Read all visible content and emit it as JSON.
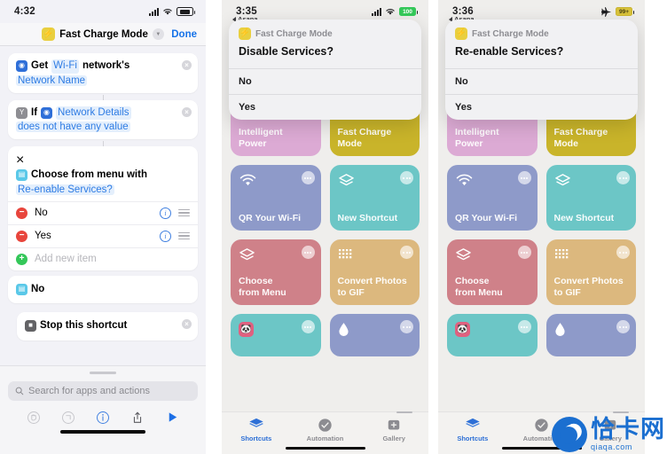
{
  "panel1": {
    "status": {
      "time": "4:32",
      "battery_text": "",
      "wifi": "wifi-icon",
      "signal": "signal-bars-icon"
    },
    "header": {
      "icon": "bolt-icon",
      "title": "Fast Charge Mode",
      "chevron": "chevron-down-icon",
      "done": "Done"
    },
    "actions": [
      {
        "icon": "wifi-action-icon",
        "line1_pre": "Get",
        "line1_var": "Wi-Fi",
        "line1_post": "network's",
        "line2": "Network Name",
        "close": "close-icon"
      },
      {
        "icon": "if-action-icon",
        "line1_pre": "If",
        "line1_var": "Network Details",
        "line1_post": "",
        "line2": "does not have any value",
        "close": "close-icon"
      }
    ],
    "menu_action": {
      "icon": "menu-action-icon",
      "title": "Choose from menu with",
      "variable": "Re-enable Services?",
      "close": "close-icon",
      "items": [
        {
          "label": "No",
          "remove": "remove-icon",
          "info": "info-icon",
          "drag": "drag-handle-icon"
        },
        {
          "label": "Yes",
          "remove": "remove-icon",
          "info": "info-icon",
          "drag": "drag-handle-icon"
        }
      ],
      "add_label": "Add new item",
      "add_icon": "add-icon"
    },
    "case_action": {
      "icon": "menu-case-icon",
      "label": "No"
    },
    "stop_action": {
      "icon": "stop-icon",
      "label": "Stop this shortcut",
      "close": "close-icon"
    },
    "search": {
      "placeholder": "Search for apps and actions",
      "icon": "search-icon"
    },
    "toolbar": [
      {
        "name": "undo-button",
        "glyph": "↺"
      },
      {
        "name": "redo-button",
        "glyph": "↻"
      },
      {
        "name": "info-button",
        "glyph": "i"
      },
      {
        "name": "share-button",
        "glyph": "↑"
      },
      {
        "name": "play-button",
        "glyph": "▶"
      }
    ]
  },
  "panel2": {
    "status": {
      "time": "3:35",
      "back_app": "Asana",
      "battery_text": "100",
      "battery_state": "green"
    },
    "dialog": {
      "app_icon": "bolt-icon",
      "app_name": "Fast Charge Mode",
      "question": "Disable Services?",
      "options": [
        "No",
        "Yes"
      ]
    },
    "tiles": [
      {
        "name": "Intelligent Power",
        "color": "#dcaad4",
        "icon": "battery-icon",
        "menu": "more-icon"
      },
      {
        "name": "Fast Charge Mode",
        "color": "#c9b42a",
        "icon": "bolt-icon",
        "menu": "message-icon"
      },
      {
        "name": "QR Your Wi-Fi",
        "color": "#8e9ac9",
        "icon": "wifi-icon",
        "menu": "more-icon"
      },
      {
        "name": "New Shortcut",
        "color": "#6cc6c6",
        "icon": "layers-icon",
        "menu": "more-icon"
      },
      {
        "name": "Choose\nfrom Menu",
        "color": "#cf8189",
        "icon": "layers-icon",
        "menu": "more-icon"
      },
      {
        "name": "Convert Photos\nto GIF",
        "color": "#dcb87e",
        "icon": "grid-icon",
        "menu": "more-icon"
      },
      {
        "name": "",
        "color": "#6cc6c6",
        "icon": "panda-icon",
        "menu": "more-icon"
      },
      {
        "name": "",
        "color": "#8e9ac9",
        "icon": "drop-icon",
        "menu": "more-icon"
      }
    ],
    "hidden_tiles": [
      {
        "color": "#7f8dbe"
      },
      {
        "color": "#7f8dbe"
      }
    ],
    "tabs": [
      {
        "label": "Shortcuts",
        "icon": "layers-icon",
        "active": true
      },
      {
        "label": "Automation",
        "icon": "clock-check-icon",
        "active": false
      },
      {
        "label": "Gallery",
        "icon": "gallery-icon",
        "active": false
      }
    ]
  },
  "panel3": {
    "status": {
      "time": "3:36",
      "back_app": "Asana",
      "battery_text": "99+",
      "battery_state": "amber",
      "airplane": "airplane-icon"
    },
    "dialog": {
      "app_icon": "bolt-icon",
      "app_name": "Fast Charge Mode",
      "question": "Re-enable Services?",
      "options": [
        "No",
        "Yes"
      ]
    },
    "tiles": [
      {
        "name": "Intelligent Power",
        "color": "#dcaad4",
        "icon": "battery-icon",
        "menu": "more-icon"
      },
      {
        "name": "Fast Charge Mode",
        "color": "#c9b42a",
        "icon": "bolt-icon",
        "menu": "message-icon"
      },
      {
        "name": "QR Your Wi-Fi",
        "color": "#8e9ac9",
        "icon": "wifi-icon",
        "menu": "more-icon"
      },
      {
        "name": "New Shortcut",
        "color": "#6cc6c6",
        "icon": "layers-icon",
        "menu": "more-icon"
      },
      {
        "name": "Choose\nfrom Menu",
        "color": "#cf8189",
        "icon": "layers-icon",
        "menu": "more-icon"
      },
      {
        "name": "Convert Photos\nto GIF",
        "color": "#dcb87e",
        "icon": "grid-icon",
        "menu": "more-icon"
      },
      {
        "name": "",
        "color": "#6cc6c6",
        "icon": "panda-icon",
        "menu": "more-icon"
      },
      {
        "name": "",
        "color": "#8e9ac9",
        "icon": "drop-icon",
        "menu": "more-icon"
      }
    ],
    "hidden_tiles": [
      {
        "color": "#7f8dbe"
      },
      {
        "color": "#7f8dbe"
      }
    ],
    "tabs": [
      {
        "label": "Shortcuts",
        "icon": "layers-icon",
        "active": true
      },
      {
        "label": "Automation",
        "icon": "clock-check-icon",
        "active": false
      },
      {
        "label": "Gallery",
        "icon": "gallery-icon",
        "active": false
      }
    ]
  },
  "watermark": {
    "cn": "恰卡网",
    "en": "qiaqa.com"
  },
  "colors": {
    "accent_blue": "#1773e8",
    "shortcut_yellow": "#c9b42a",
    "destructive_red": "#e8453c",
    "add_green": "#34c759"
  }
}
